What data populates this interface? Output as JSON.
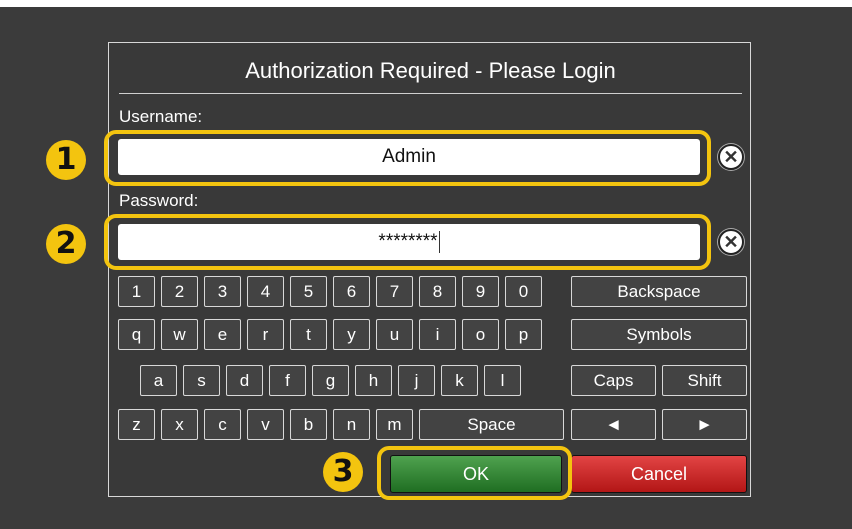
{
  "dialog": {
    "title": "Authorization Required - Please Login",
    "username_label": "Username:",
    "username_value": "Admin",
    "password_label": "Password:",
    "password_value": "********"
  },
  "badges": [
    "1",
    "2",
    "3"
  ],
  "keyboard": {
    "row1": [
      "1",
      "2",
      "3",
      "4",
      "5",
      "6",
      "7",
      "8",
      "9",
      "0"
    ],
    "row1_wide": "Backspace",
    "row2": [
      "q",
      "w",
      "e",
      "r",
      "t",
      "y",
      "u",
      "i",
      "o",
      "p"
    ],
    "row2_wide": "Symbols",
    "row3": [
      "a",
      "s",
      "d",
      "f",
      "g",
      "h",
      "j",
      "k",
      "l"
    ],
    "row3_caps": "Caps",
    "row3_shift": "Shift",
    "row4": [
      "z",
      "x",
      "c",
      "v",
      "b",
      "n",
      "m"
    ],
    "row4_space": "Space",
    "row4_left": "◄",
    "row4_right": "►"
  },
  "buttons": {
    "ok": "OK",
    "cancel": "Cancel"
  },
  "colors": {
    "highlight": "#f3c40f",
    "ok": "#2e7d32",
    "cancel": "#d32f2f",
    "background": "#3b3b3b"
  }
}
